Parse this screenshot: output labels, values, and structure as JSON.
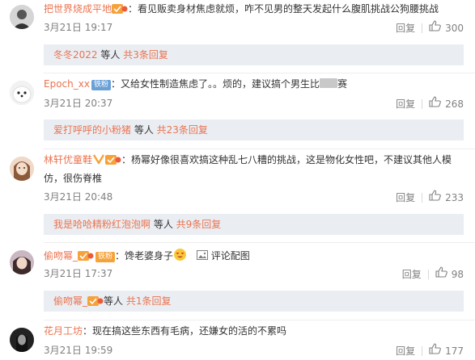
{
  "comments": [
    {
      "user": "把世界烧成平地",
      "colon": "：",
      "text": "看见贩卖身材焦虑就烦，咋不见男的整天发起什么腹肌挑战公狗腰挑战",
      "time": "3月21日 19:17",
      "reply_label": "回复",
      "likes": "300",
      "sub": {
        "user": "冬冬2022",
        "mid": " 等人 ",
        "more": "共3条回复"
      }
    },
    {
      "user": "Epoch_xx",
      "badge": "铁粉",
      "colon": "：",
      "text_a": "又给女性制造焦虑了。。烦的，建议搞个男生比",
      "text_b": "赛",
      "time": "3月21日 20:37",
      "reply_label": "回复",
      "likes": "268",
      "sub": {
        "user": "爱打呼呼的小粉猪",
        "mid": " 等人 ",
        "more": "共23条回复"
      }
    },
    {
      "user": "林轩优童鞋",
      "colon": "：",
      "text": "杨幂好像很喜欢搞这种乱七八糟的挑战，这是物化女性吧，不建议其他人模仿，很伤脊椎",
      "time": "3月21日 20:48",
      "reply_label": "回复",
      "likes": "233",
      "sub": {
        "user": "我是哈哈精粉红泡泡啊",
        "mid": " 等人 ",
        "more": "共9条回复"
      }
    },
    {
      "user": "偷吻幂_",
      "badge": "铁粉",
      "colon": "：",
      "text": "馋老婆身子",
      "pic_label": "评论配图",
      "time": "3月21日 17:37",
      "reply_label": "回复",
      "likes": "98",
      "sub": {
        "user": "偷吻幂_",
        "mid": "等人 ",
        "more": "共1条回复"
      }
    },
    {
      "user": "花月工坊",
      "colon": "：",
      "text": "现在搞这些东西有毛病，还嫌女的活的不累吗",
      "time": "3月21日 19:59",
      "reply_label": "回复",
      "likes": "177"
    }
  ]
}
